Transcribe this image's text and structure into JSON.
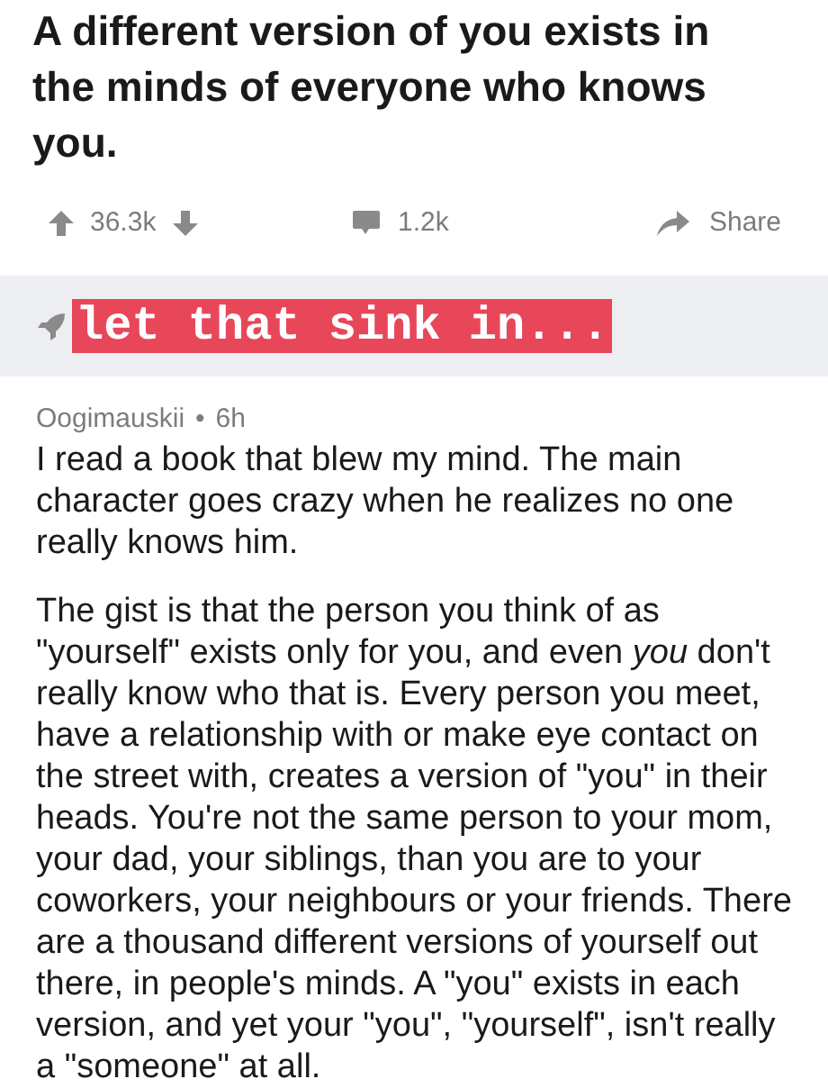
{
  "post": {
    "title": "A different version of you exists in the minds of everyone who knows you.",
    "upvotes": "36.3k",
    "comments": "1.2k",
    "share": "Share"
  },
  "flair": {
    "text": "let that sink in..."
  },
  "comment": {
    "author": "Oogimauskii",
    "separator": "•",
    "time": "6h",
    "paragraphs": [
      "I read a book that blew my mind. The main character goes crazy when he realizes no one really knows him.",
      "The gist is that the person you think of as \"yourself\" exists only for you, and even *you* don't really know who that is. Every person you meet, have a relationship with or make eye contact on the street with, creates a version of \"you\" in their heads. You're not the same person to your mom, your dad, your siblings, than you are to your coworkers, your neighbours or your friends. There are a thousand different versions of yourself out there, in people's minds. A \"you\" exists in each version, and yet your \"you\", \"yourself\", isn't really a \"someone\" at all."
    ]
  }
}
